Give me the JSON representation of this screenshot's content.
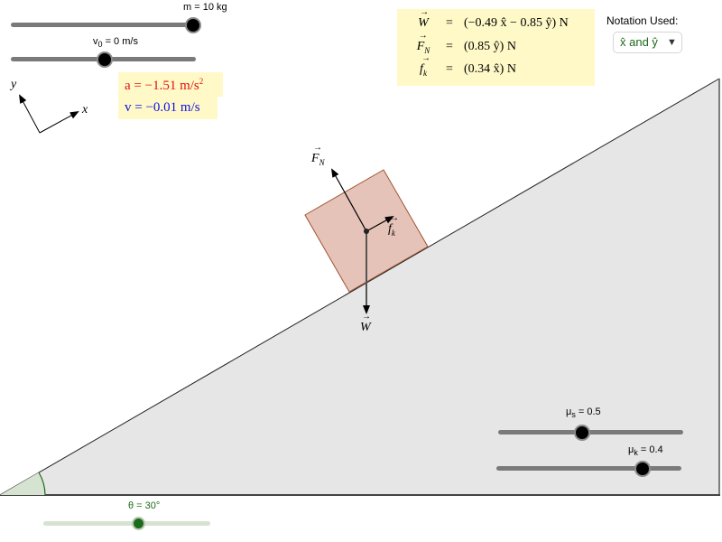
{
  "sliders": {
    "mass": {
      "label": "m = 10 kg",
      "value": 10,
      "unit": "kg",
      "fraction": 1.0
    },
    "v0": {
      "label_main": "v",
      "label_sub": "0",
      "label_rest": " = 0 m/s",
      "value": 0,
      "unit": "m/s",
      "fraction": 0.5
    },
    "theta": {
      "label": "θ = 30°",
      "value": 30,
      "unit": "°",
      "fraction": 0.57
    },
    "mu_s": {
      "label_main": "μ",
      "label_sub": "s",
      "label_rest": " = 0.5",
      "value": 0.5,
      "fraction": 0.45
    },
    "mu_k": {
      "label_main": "μ",
      "label_sub": "k",
      "label_rest": " = 0.4",
      "value": 0.4,
      "fraction": 0.79
    }
  },
  "readouts": {
    "acceleration": {
      "text": "a = −1.51 m/s",
      "sup": "2",
      "color": "#e01010"
    },
    "velocity": {
      "text": "v = −0.01 m/s",
      "color": "#1010e0"
    }
  },
  "equations": [
    {
      "lhs": "W",
      "lhs_sub": "",
      "eq": "=",
      "rhs": "(−0.49 x̂ − 0.85 ŷ) N"
    },
    {
      "lhs": "F",
      "lhs_sub": "N",
      "eq": "=",
      "rhs": "(0.85 ŷ) N"
    },
    {
      "lhs": "f",
      "lhs_sub": "k",
      "eq": "=",
      "rhs": "(0.34 x̂) N"
    }
  ],
  "notation": {
    "label": "Notation Used:",
    "selected": "x̂ and ŷ",
    "caret": "▼"
  },
  "axes": {
    "x_label": "x",
    "y_label": "y"
  },
  "vectors": {
    "normal": {
      "label": "F",
      "sub": "N"
    },
    "friction": {
      "label": "f",
      "sub": "k"
    },
    "weight": {
      "label": "W",
      "sub": ""
    }
  },
  "colors": {
    "ramp_fill": "#e6e6e6",
    "block_fill": "#e6c3b8",
    "block_stroke": "#a0522d",
    "angle_fill": "#d5e3d0",
    "angle_stroke": "#1a6b1a",
    "theta_color": "#1a6b1a",
    "math_bg": "#fff9c8"
  }
}
